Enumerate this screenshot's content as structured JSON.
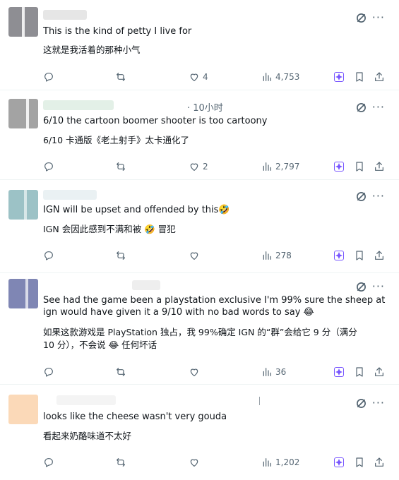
{
  "colors": {
    "accent": "#7856ff",
    "muted": "#536471",
    "text": "#0f1419"
  },
  "icons": {
    "reply": "reply-icon",
    "retweet": "retweet-icon",
    "like": "heart-icon",
    "views": "views-icon",
    "boost": "boost-icon",
    "bookmark": "bookmark-icon",
    "share": "share-icon",
    "grok": "grok-icon",
    "more": "more-icon"
  },
  "posts": [
    {
      "time": "",
      "text_en": "This is the kind of petty I live for",
      "text_zh": "这就是我活着的那种小气",
      "likes": "4",
      "views": "4,753"
    },
    {
      "time": "· 10小时",
      "text_en": "6/10 the cartoon boomer shooter is too cartoony",
      "text_zh": "6/10 卡通版《老土射手》太卡通化了",
      "likes": "2",
      "views": "2,797"
    },
    {
      "time": "",
      "text_en": "IGN  will be upset and offended by this🤣",
      "text_zh": "IGN 会因此感到不满和被 🤣 冒犯",
      "likes": "",
      "views": "278"
    },
    {
      "time": "",
      "text_en_1": "See had the game been a playstation exclusive I'm 99% sure the sheep at",
      "text_en_2": "ign would have given it a 9/10 with no bad words to say 😂",
      "text_zh_1": "如果这款游戏是 PlayStation 独占，我 99%确定 IGN 的“群”会给它 9 分（满分",
      "text_zh_2": "10 分），不会说 😂 任何坏话",
      "likes": "",
      "views": "36"
    },
    {
      "time": "",
      "text_en": "looks like the cheese wasn't very gouda",
      "text_zh": "看起来奶酪味道不太好",
      "likes": "",
      "views": "1,202"
    }
  ]
}
